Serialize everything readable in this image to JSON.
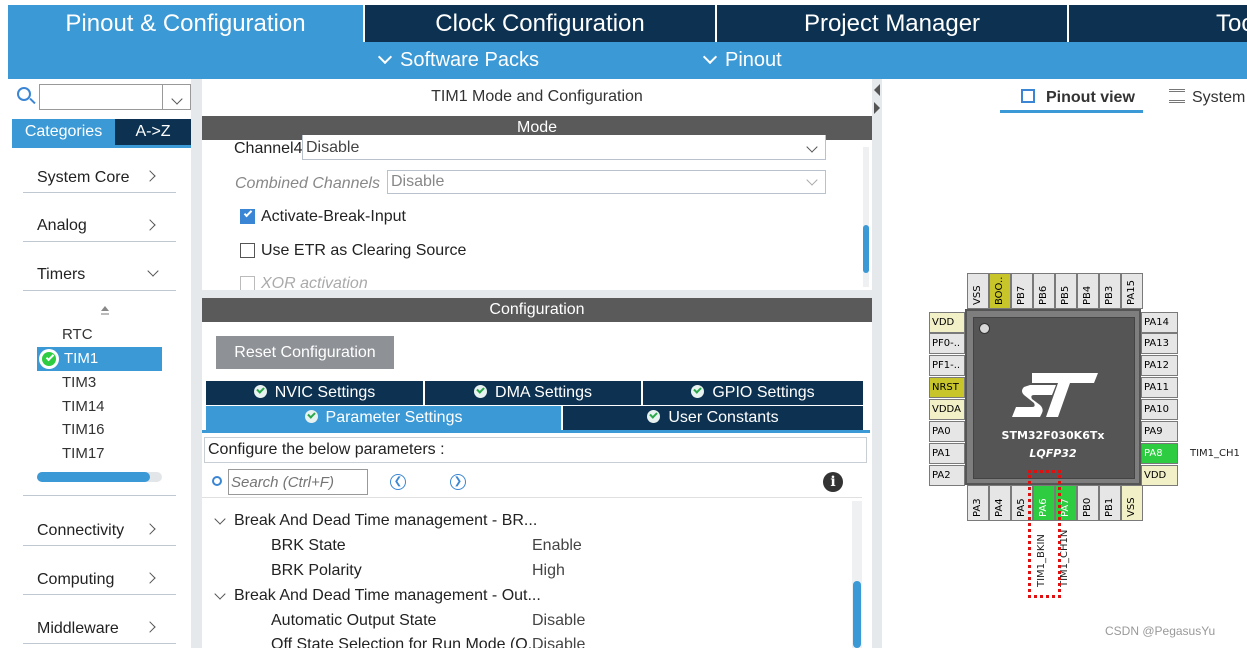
{
  "top_tabs": [
    "Pinout & Configuration",
    "Clock Configuration",
    "Project Manager",
    "Tools"
  ],
  "sub_bar": {
    "software_packs": "Software Packs",
    "pinout": "Pinout"
  },
  "left": {
    "search_value": "",
    "tabs": {
      "categories": "Categories",
      "az": "A->Z"
    },
    "categories": [
      "System Core",
      "Analog",
      "Timers",
      "Connectivity",
      "Computing",
      "Middleware"
    ],
    "timers": [
      "RTC",
      "TIM1",
      "TIM3",
      "TIM14",
      "TIM16",
      "TIM17"
    ]
  },
  "mode_panel": {
    "title": "TIM1 Mode and Configuration",
    "mode_header": "Mode",
    "channel4_label": "Channel4",
    "channel4_value": "Disable",
    "combined_label": "Combined Channels",
    "combined_value": "Disable",
    "activate_break": "Activate-Break-Input",
    "use_etr": "Use ETR as Clearing Source",
    "xor": "XOR activation"
  },
  "config_panel": {
    "header": "Configuration",
    "reset_button": "Reset Configuration",
    "tabs_row1": [
      "NVIC Settings",
      "DMA Settings",
      "GPIO Settings"
    ],
    "tabs_row2": [
      "Parameter Settings",
      "User Constants"
    ],
    "configure_label": "Configure the below parameters :",
    "search_placeholder": "Search (Ctrl+F)",
    "groups": [
      {
        "title": "Break And Dead Time management - BR...",
        "params": [
          {
            "name": "BRK State",
            "value": "Enable"
          },
          {
            "name": "BRK Polarity",
            "value": "High"
          }
        ]
      },
      {
        "title": "Break And Dead Time management - Out...",
        "params": [
          {
            "name": "Automatic Output State",
            "value": "Disable"
          },
          {
            "name": "Off State Selection for Run Mode (O...",
            "value": "Disable"
          }
        ]
      }
    ]
  },
  "view_tabs": {
    "pinout_view": "Pinout view",
    "system_view": "System"
  },
  "chip": {
    "part": "STM32F030K6Tx",
    "package": "LQFP32",
    "top_pins": [
      "VSS",
      "BOO..",
      "PB7",
      "PB6",
      "PB5",
      "PB4",
      "PB3",
      "PA15"
    ],
    "left_pins": [
      "VDD",
      "PF0-..",
      "PF1-..",
      "NRST",
      "VDDA",
      "PA0",
      "PA1",
      "PA2"
    ],
    "right_pins": [
      "PA14",
      "PA13",
      "PA12",
      "PA11",
      "PA10",
      "PA9",
      "PA8",
      "VDD"
    ],
    "bottom_pins": [
      "PA3",
      "PA4",
      "PA5",
      "PA6",
      "PA7",
      "PB0",
      "PB1",
      "VSS"
    ],
    "right_label": "TIM1_CH1",
    "bottom_labels": [
      "TIM1_BKIN",
      "TIM1_CH1N"
    ]
  },
  "watermark": "CSDN @PegasusYu",
  "colors": {
    "dark_navy": "#0d3251",
    "accent_blue": "#3b99d6",
    "pin_green": "#2ecc40"
  }
}
